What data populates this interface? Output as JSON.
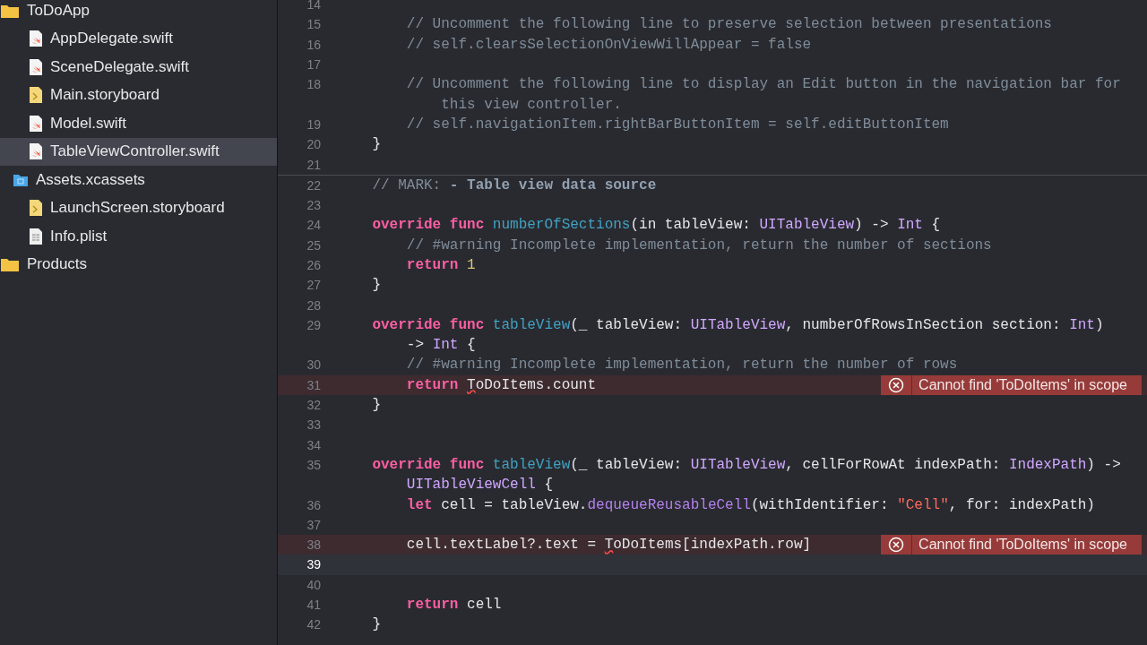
{
  "navigator": {
    "items": [
      {
        "name": "ToDoApp",
        "kind": "folder",
        "selected": false,
        "children": [
          {
            "name": "AppDelegate.swift",
            "kind": "swift",
            "selected": false
          },
          {
            "name": "SceneDelegate.swift",
            "kind": "swift",
            "selected": false
          },
          {
            "name": "Main.storyboard",
            "kind": "storyboard",
            "selected": false
          },
          {
            "name": "Model.swift",
            "kind": "swift",
            "selected": false
          },
          {
            "name": "TableViewController.swift",
            "kind": "swift",
            "selected": true
          },
          {
            "name": "Assets.xcassets",
            "kind": "assets",
            "selected": false
          },
          {
            "name": "LaunchScreen.storyboard",
            "kind": "storyboard",
            "selected": false
          },
          {
            "name": "Info.plist",
            "kind": "plist",
            "selected": false
          }
        ]
      },
      {
        "name": "Products",
        "kind": "folder",
        "selected": false
      }
    ]
  },
  "editor": {
    "lines": [
      {
        "number": "14",
        "current": false,
        "rows": [
          []
        ]
      },
      {
        "number": "15",
        "current": false,
        "rows": [
          [
            {
              "kind": "c",
              "text": "        // Uncomment the following line to preserve selection between presentations"
            }
          ]
        ]
      },
      {
        "number": "16",
        "current": false,
        "rows": [
          [
            {
              "kind": "c",
              "text": "        // self.clearsSelectionOnViewWillAppear = false"
            }
          ]
        ]
      },
      {
        "number": "17",
        "current": false,
        "rows": [
          []
        ]
      },
      {
        "number": "18",
        "current": false,
        "rows": [
          {
            "segments": [
              {
                "kind": "c",
                "text": "        // Uncomment the following line to display an Edit button in the navigation bar for"
              }
            ]
          },
          {
            "segments": [
              {
                "kind": "c",
                "text": "            this view controller."
              }
            ]
          }
        ]
      },
      {
        "number": "19",
        "current": false,
        "rows": [
          [
            {
              "kind": "c",
              "text": "        // self.navigationItem.rightBarButtonItem = self.editButtonItem"
            }
          ]
        ]
      },
      {
        "number": "20",
        "current": false,
        "rows": [
          [
            {
              "kind": "p",
              "text": "    }"
            }
          ]
        ]
      },
      {
        "number": "21",
        "current": false,
        "rows": [
          []
        ]
      },
      {
        "number": "22",
        "current": false,
        "rows": [
          [
            {
              "kind": "c",
              "text": "    // MARK: "
            },
            {
              "kind": "mk",
              "text": "- Table view data source"
            }
          ]
        ]
      },
      {
        "number": "23",
        "current": false,
        "rows": [
          []
        ]
      },
      {
        "number": "24",
        "current": false,
        "rows": [
          [
            {
              "kind": "k",
              "text": "    override func "
            },
            {
              "kind": "f",
              "text": "numberOfSections"
            },
            {
              "kind": "p",
              "text": "(in tableView: "
            },
            {
              "kind": "t",
              "text": "UITableView"
            },
            {
              "kind": "p",
              "text": ") -> "
            },
            {
              "kind": "t",
              "text": "Int"
            },
            {
              "kind": "p",
              "text": " {"
            }
          ]
        ]
      },
      {
        "number": "25",
        "current": false,
        "rows": [
          [
            {
              "kind": "c",
              "text": "        // #warning Incomplete implementation, return the number of sections"
            }
          ]
        ]
      },
      {
        "number": "26",
        "current": false,
        "rows": [
          [
            {
              "kind": "k",
              "text": "        return "
            },
            {
              "kind": "n",
              "text": "1"
            }
          ]
        ]
      },
      {
        "number": "27",
        "current": false,
        "rows": [
          [
            {
              "kind": "p",
              "text": "    }"
            }
          ]
        ]
      },
      {
        "number": "28",
        "current": false,
        "rows": [
          []
        ]
      },
      {
        "number": "29",
        "current": false,
        "rows": [
          {
            "segments": [
              {
                "kind": "k",
                "text": "    override func "
              },
              {
                "kind": "f",
                "text": "tableView"
              },
              {
                "kind": "p",
                "text": "(_ tableView: "
              },
              {
                "kind": "t",
                "text": "UITableView"
              },
              {
                "kind": "p",
                "text": ", numberOfRowsInSection section: "
              },
              {
                "kind": "t",
                "text": "Int"
              },
              {
                "kind": "p",
                "text": ")"
              }
            ]
          },
          {
            "segments": [
              {
                "kind": "p",
                "text": "        -> "
              },
              {
                "kind": "t",
                "text": "Int"
              },
              {
                "kind": "p",
                "text": " {"
              }
            ]
          }
        ]
      },
      {
        "number": "30",
        "current": false,
        "rows": [
          [
            {
              "kind": "c",
              "text": "        // #warning Incomplete implementation, return the number of rows"
            }
          ]
        ]
      },
      {
        "number": "31",
        "current": false,
        "error": "Cannot find 'ToDoItems' in scope",
        "rows": [
          [
            {
              "kind": "k",
              "text": "        return "
            },
            {
              "kind": "e",
              "text": "T"
            },
            {
              "kind": "p",
              "text": "oDoItems.count"
            }
          ]
        ]
      },
      {
        "number": "32",
        "current": false,
        "rows": [
          [
            {
              "kind": "p",
              "text": "    }"
            }
          ]
        ]
      },
      {
        "number": "33",
        "current": false,
        "rows": [
          []
        ]
      },
      {
        "number": "34",
        "current": false,
        "rows": [
          []
        ]
      },
      {
        "number": "35",
        "current": false,
        "rows": [
          {
            "segments": [
              {
                "kind": "k",
                "text": "    override func "
              },
              {
                "kind": "f",
                "text": "tableView"
              },
              {
                "kind": "p",
                "text": "(_ tableView: "
              },
              {
                "kind": "t",
                "text": "UITableView"
              },
              {
                "kind": "p",
                "text": ", cellForRowAt indexPath: "
              },
              {
                "kind": "t",
                "text": "IndexPath"
              },
              {
                "kind": "p",
                "text": ") ->"
              }
            ]
          },
          {
            "segments": [
              {
                "kind": "t",
                "text": "        UITableViewCell"
              },
              {
                "kind": "p",
                "text": " {"
              }
            ]
          }
        ]
      },
      {
        "number": "36",
        "current": false,
        "rows": [
          [
            {
              "kind": "k",
              "text": "        let "
            },
            {
              "kind": "p",
              "text": "cell = tableView."
            },
            {
              "kind": "m",
              "text": "dequeueReusableCell"
            },
            {
              "kind": "p",
              "text": "(withIdentifier: "
            },
            {
              "kind": "s",
              "text": "\"Cell\""
            },
            {
              "kind": "p",
              "text": ", for: indexPath)"
            }
          ]
        ]
      },
      {
        "number": "37",
        "current": false,
        "rows": [
          []
        ]
      },
      {
        "number": "38",
        "current": false,
        "error": "Cannot find 'ToDoItems' in scope",
        "rows": [
          [
            {
              "kind": "p",
              "text": "        cell.textLabel?.text = "
            },
            {
              "kind": "e",
              "text": "T"
            },
            {
              "kind": "p",
              "text": "oDoItems[indexPath.row]"
            }
          ]
        ]
      },
      {
        "number": "39",
        "current": true,
        "rows": [
          []
        ]
      },
      {
        "number": "40",
        "current": false,
        "rows": [
          []
        ]
      },
      {
        "number": "41",
        "current": false,
        "rows": [
          [
            {
              "kind": "k",
              "text": "        return "
            },
            {
              "kind": "p",
              "text": "cell"
            }
          ]
        ]
      },
      {
        "number": "42",
        "current": false,
        "rows": [
          [
            {
              "kind": "p",
              "text": "    }"
            }
          ]
        ]
      }
    ]
  }
}
